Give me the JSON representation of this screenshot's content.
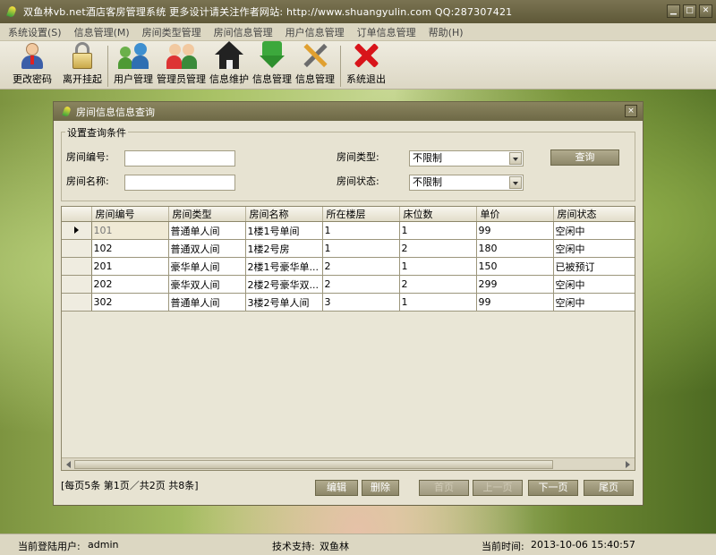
{
  "window": {
    "title": "双鱼林vb.net酒店客房管理系统      更多设计请关注作者网站: http://www.shuangyulin.com   QQ:287307421"
  },
  "menu": [
    "系统设置(S)",
    "信息管理(M)",
    "房间类型管理",
    "房间信息管理",
    "用户信息管理",
    "订单信息管理",
    "帮助(H)"
  ],
  "toolbar": {
    "change_password": "更改密码",
    "leave": "离开挂起",
    "user_manage": "用户管理",
    "admin_manage": "管理员管理",
    "info_maintain": "信息维护",
    "info_manage1": "信息管理",
    "info_manage2": "信息管理",
    "exit": "系统退出"
  },
  "child": {
    "title": "房间信息信息查询",
    "close": "×"
  },
  "query": {
    "group_label": "设置查询条件",
    "room_no_label": "房间编号:",
    "room_name_label": "房间名称:",
    "room_no_value": "",
    "room_name_value": "",
    "room_type_label": "房间类型:",
    "room_status_label": "房间状态:",
    "room_type_value": "不限制",
    "room_status_value": "不限制",
    "search_button": "查询"
  },
  "table": {
    "columns": [
      "房间编号",
      "房间类型",
      "房间名称",
      "所在楼层",
      "床位数",
      "单价",
      "房间状态"
    ],
    "rows": [
      [
        "101",
        "普通单人间",
        "1楼1号单间",
        "1",
        "1",
        "99",
        "空闲中"
      ],
      [
        "102",
        "普通双人间",
        "1楼2号房",
        "1",
        "2",
        "180",
        "空闲中"
      ],
      [
        "201",
        "豪华单人间",
        "2楼1号豪华单...",
        "2",
        "1",
        "150",
        "已被预订"
      ],
      [
        "202",
        "豪华双人间",
        "2楼2号豪华双...",
        "2",
        "2",
        "299",
        "空闲中"
      ],
      [
        "302",
        "普通单人间",
        "3楼2号单人间",
        "3",
        "1",
        "99",
        "空闲中"
      ]
    ]
  },
  "pager": {
    "info": "[每页5条  第1页／共2页     共8条]",
    "edit": "编辑",
    "delete": "删除",
    "first": "首页",
    "prev": "上一页",
    "next": "下一页",
    "last": "尾页"
  },
  "status": {
    "user_label": "当前登陆用户:",
    "user_value": "admin",
    "support_label": "技术支持:",
    "support_value": "双鱼林",
    "time_label": "当前时间:",
    "time_value": "2013-10-06 15:40:57"
  }
}
